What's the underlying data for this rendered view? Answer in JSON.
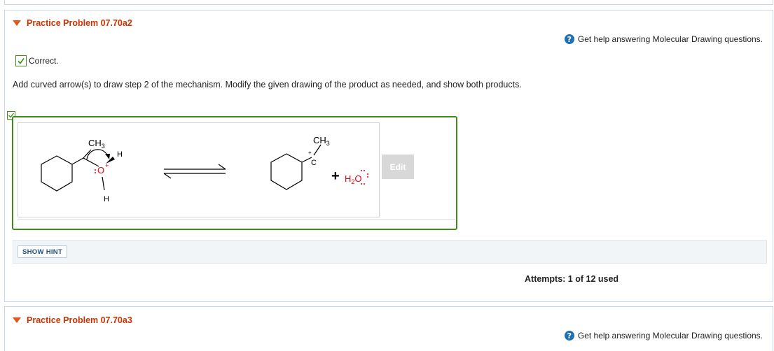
{
  "problem1": {
    "title": "Practice Problem 07.70a2",
    "help_text": "Get help answering Molecular Drawing questions.",
    "status": "Correct.",
    "instructions": "Add curved arrow(s) to draw step 2 of the mechanism. Modify the given drawing of the product as needed, and show both products.",
    "edit_label": "Edit",
    "hint_label": "SHOW HINT",
    "attempts_text": "Attempts: 1 of 12 used"
  },
  "drawing": {
    "reactant_methyl": "CH",
    "reactant_methyl_sub": "3",
    "reactant_h_top": "H",
    "reactant_o": "O",
    "reactant_charge": "+",
    "reactant_h_bottom": "H",
    "product_methyl": "CH",
    "product_methyl_sub": "3",
    "product_carbon": "C",
    "product_charge": "+",
    "plus_sign": "+",
    "water_h": "H",
    "water_sub": "2",
    "water_o": "O"
  },
  "problem2": {
    "title": "Practice Problem 07.70a3",
    "help_text": "Get help answering Molecular Drawing questions."
  },
  "colors": {
    "title_orange": "#cc3300",
    "correct_green": "#3f8c1b",
    "help_blue": "#1c6fb5",
    "oxygen_red": "#e8000d"
  },
  "icons": [
    "expand-triangle-icon",
    "help-icon",
    "check-icon"
  ]
}
